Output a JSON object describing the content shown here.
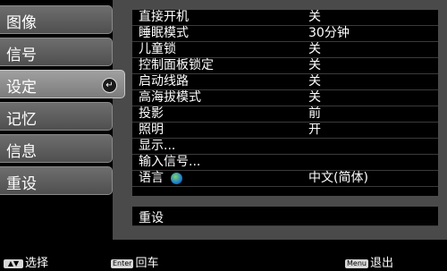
{
  "sidebar": {
    "items": [
      {
        "label": "图像"
      },
      {
        "label": "信号"
      },
      {
        "label": "设定"
      },
      {
        "label": "记忆"
      },
      {
        "label": "信息"
      },
      {
        "label": "重设"
      }
    ],
    "active_index": 2
  },
  "menu": {
    "rows": [
      {
        "label": "直接开机",
        "value": "关"
      },
      {
        "label": "睡眠模式",
        "value": "30分钟"
      },
      {
        "label": "儿童锁",
        "value": "关"
      },
      {
        "label": "控制面板锁定",
        "value": "关"
      },
      {
        "label": "启动线路",
        "value": "关"
      },
      {
        "label": "高海拔模式",
        "value": "关"
      },
      {
        "label": "投影",
        "value": "前"
      },
      {
        "label": "照明",
        "value": "开"
      },
      {
        "label": "显示...",
        "value": ""
      },
      {
        "label": "输入信号...",
        "value": ""
      },
      {
        "label": "语言",
        "value": "中文(简体)",
        "icon": "globe-icon"
      }
    ],
    "reset_label": "重设"
  },
  "footer": {
    "select_key": "▲▼",
    "select_label": "选择",
    "enter_key": "Enter",
    "enter_label": "回车",
    "menu_key": "Menu",
    "menu_label": "退出"
  },
  "colors": {
    "panel_bg": "#4a4a4a",
    "tab_bg": "#5f5f5f",
    "active_tab_bg": "#8c8c8c"
  }
}
